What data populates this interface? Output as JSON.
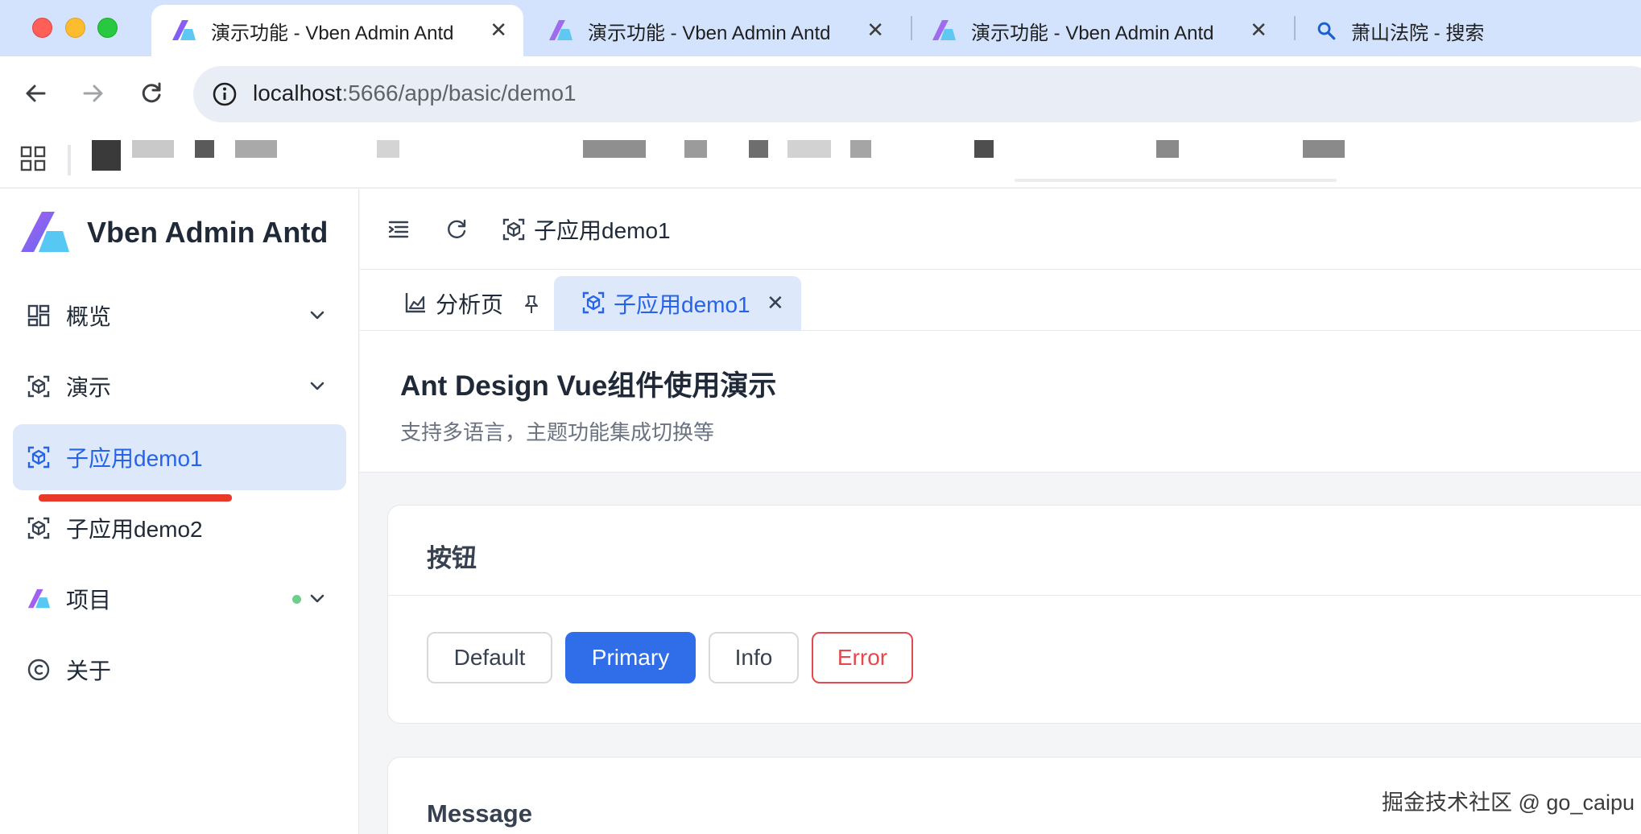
{
  "browser": {
    "tabs": [
      {
        "title": "演示功能 - Vben Admin Antd",
        "active": true,
        "icon": "vben-logo-icon"
      },
      {
        "title": "演示功能 - Vben Admin Antd",
        "active": false,
        "icon": "vben-logo-icon"
      },
      {
        "title": "演示功能 - Vben Admin Antd",
        "active": false,
        "icon": "vben-logo-icon"
      },
      {
        "title": "萧山法院 - 搜索",
        "active": false,
        "icon": "search-icon"
      }
    ],
    "url_host": "localhost",
    "url_path": ":5666/app/basic/demo1",
    "colors": {
      "tabstrip": "#d3e3fd",
      "omnibox": "#e9eef6"
    }
  },
  "sidebar": {
    "brand": "Vben Admin Antd",
    "items": [
      {
        "label": "概览",
        "icon": "dashboard-grid-icon",
        "expandable": true
      },
      {
        "label": "演示",
        "icon": "cube-scan-icon",
        "expandable": true
      },
      {
        "label": "子应用demo1",
        "icon": "cube-scan-icon",
        "active": true
      },
      {
        "label": "子应用demo2",
        "icon": "cube-scan-icon"
      },
      {
        "label": "项目",
        "icon": "vben-logo-icon",
        "expandable": true,
        "badge_dot": true
      },
      {
        "label": "关于",
        "icon": "copyright-icon"
      }
    ],
    "accent": "#2563eb"
  },
  "header": {
    "breadcrumb": "子应用demo1"
  },
  "page_tabs": [
    {
      "label": "分析页",
      "icon": "area-chart-icon",
      "action": "pin-icon"
    },
    {
      "label": "子应用demo1",
      "icon": "cube-scan-icon",
      "action": "close-icon",
      "active": true
    }
  ],
  "page": {
    "title": "Ant Design Vue组件使用演示",
    "description": "支持多语言，主题功能集成切换等"
  },
  "cards": {
    "buttons": {
      "title": "按钮",
      "labels": {
        "default": "Default",
        "primary": "Primary",
        "info": "Info",
        "error": "Error"
      }
    },
    "message": {
      "title": "Message"
    }
  },
  "watermark": "掘金技术社区 @ go_caipu"
}
